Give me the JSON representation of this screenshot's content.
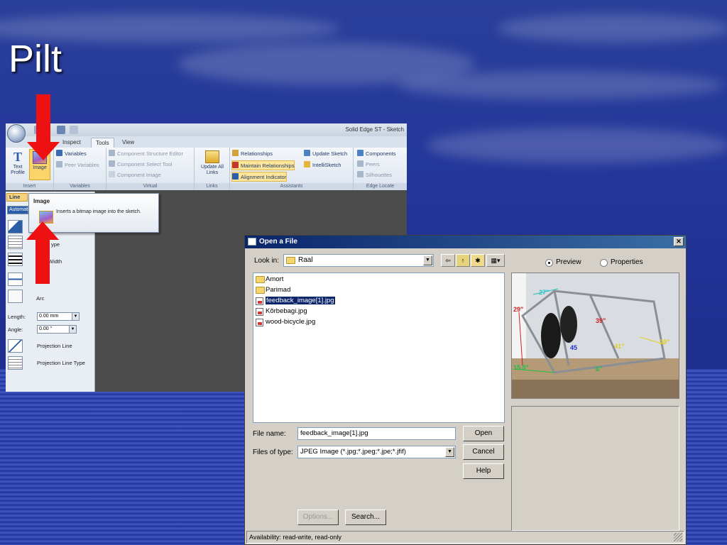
{
  "slide": {
    "title": "Pilt"
  },
  "solid_edge": {
    "window_title": "Solid Edge ST - Sketch",
    "tabs": [
      "Inspect",
      "Tools",
      "View"
    ],
    "active_tab": "Tools",
    "insert_group": {
      "label": "Insert",
      "text_profile": "Text Profile",
      "image": "Image"
    },
    "variables_group": {
      "label": "Variables",
      "variables": "Variables",
      "peer_variables": "Peer Variables"
    },
    "virtual_group": {
      "label": "Virtual",
      "component_structure_editor": "Component Structure Editor",
      "component_select_tool": "Component Select Tool",
      "component_image": "Component Image"
    },
    "links_group": {
      "label": "Links",
      "update_all_links": "Update All Links"
    },
    "assistants_group": {
      "label": "Assistants",
      "relationships": "Relationships",
      "update_sketch": "Update Sketch",
      "maintain_relationships": "Maintain Relationships",
      "intellisketch": "IntelliSketch",
      "alignment_indicator": "Alignment Indicator"
    },
    "edge_locate_group": {
      "label": "Edge Locate",
      "components": "Components",
      "peers": "Peers",
      "silhouettes": "Silhouettes"
    },
    "line_tab": "Line",
    "left_panel": {
      "combo_value": "Automati",
      "type_label": "ype",
      "width_label": "Width",
      "arc_label": "Arc",
      "length_label": "Length:",
      "length_value": "0.00 mm",
      "angle_label": "Angle:",
      "angle_value": "0.00 °",
      "projection_line": "Projection Line",
      "projection_line_type": "Projection Line Type"
    },
    "tooltip": {
      "title": "Image",
      "description": "Inserts a bitmap image into the sketch."
    }
  },
  "open_dialog": {
    "title": "Open a File",
    "look_in_label": "Look in:",
    "look_in_value": "Raal",
    "files": [
      {
        "name": "Amort",
        "type": "folder",
        "selected": false
      },
      {
        "name": "Parimad",
        "type": "folder",
        "selected": false
      },
      {
        "name": "feedback_image[1].jpg",
        "type": "jpg",
        "selected": true
      },
      {
        "name": "Kõrbebagi.jpg",
        "type": "jpg",
        "selected": false
      },
      {
        "name": "wood-bicycle.jpg",
        "type": "jpg",
        "selected": false
      }
    ],
    "file_name_label": "File name:",
    "file_name_value": "feedback_image[1].jpg",
    "files_of_type_label": "Files of type:",
    "files_of_type_value": "JPEG Image (*.jpg;*.jpeg;*.jpe;*.jfif)",
    "open_button": "Open",
    "cancel_button": "Cancel",
    "help_button": "Help",
    "options_button": "Options...",
    "search_button": "Search...",
    "preview_radio": "Preview",
    "properties_radio": "Properties",
    "status": "Availability: read-write, read-only",
    "preview_dimensions": [
      "27\"",
      "29\"",
      "39\"",
      "29\"",
      "41\"",
      "15.5\"",
      "45",
      "6\""
    ]
  },
  "colors": {
    "accent_red": "#ee1111",
    "selection_blue": "#0a246a"
  }
}
